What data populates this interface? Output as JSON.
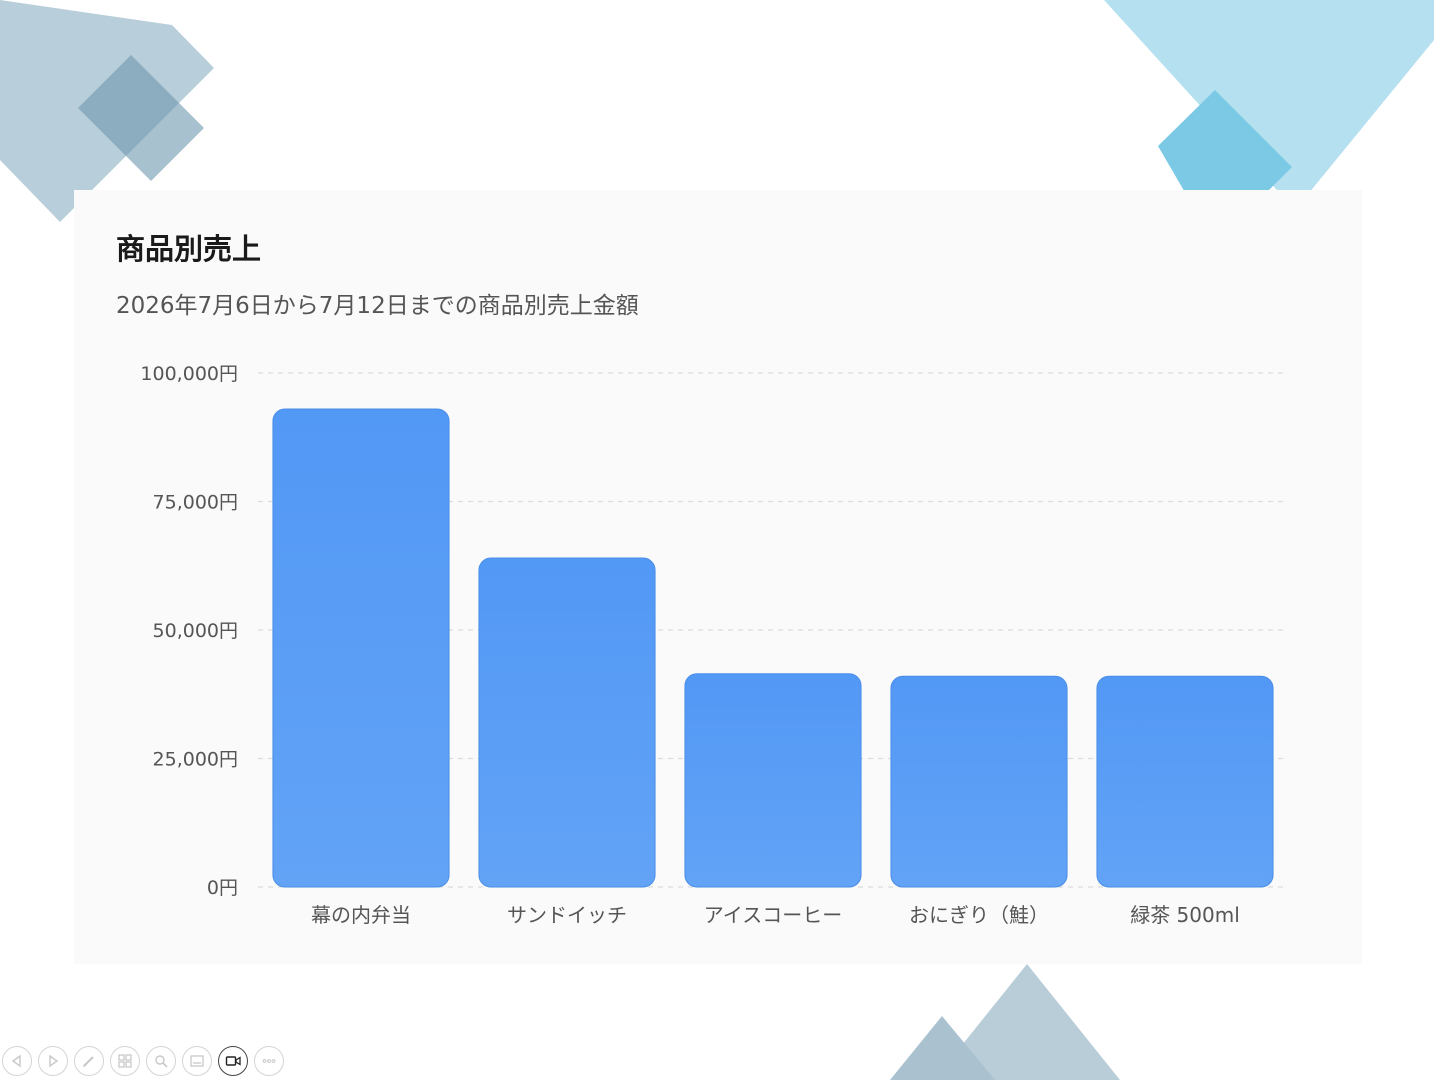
{
  "chart_data": {
    "type": "bar",
    "title": "商品別売上",
    "subtitle": "2026年7月6日から7月12日までの商品別売上金額",
    "categories": [
      "幕の内弁当",
      "サンドイッチ",
      "アイスコーヒー",
      "おにぎり（鮭）",
      "緑茶 500ml"
    ],
    "values": [
      93000,
      64000,
      41500,
      41000,
      41000
    ],
    "ylim": [
      0,
      100000
    ],
    "yticks": [
      0,
      25000,
      50000,
      75000,
      100000
    ],
    "ytick_labels": [
      "0円",
      "25,000円",
      "50,000円",
      "75,000円",
      "100,000円"
    ],
    "xlabel": "",
    "ylabel": "",
    "grid": true,
    "legend": "none",
    "bar_color_top": "#5298f5",
    "bar_color_bottom": "#62a3f6"
  },
  "toolbar": {
    "buttons": [
      {
        "name": "previous-slide-button",
        "icon": "triangle-left-icon"
      },
      {
        "name": "next-slide-button",
        "icon": "triangle-right-icon"
      },
      {
        "name": "pen-button",
        "icon": "pen-icon"
      },
      {
        "name": "slides-overview-button",
        "icon": "grid-icon"
      },
      {
        "name": "zoom-button",
        "icon": "magnifier-icon"
      },
      {
        "name": "subtitles-button",
        "icon": "subtitles-icon"
      },
      {
        "name": "camera-button",
        "icon": "video-camera-icon"
      },
      {
        "name": "more-options-button",
        "icon": "more-icon"
      }
    ]
  }
}
